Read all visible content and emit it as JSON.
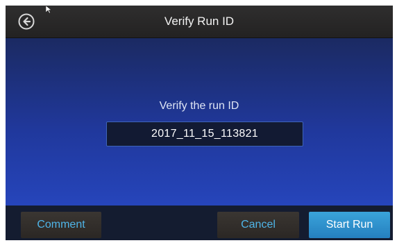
{
  "header": {
    "title": "Verify Run ID",
    "back_icon": "back-arrow-circle-icon"
  },
  "main": {
    "prompt": "Verify the run ID",
    "run_id": "2017_11_15_113821"
  },
  "footer": {
    "comment_label": "Comment",
    "cancel_label": "Cancel",
    "start_label": "Start Run"
  },
  "colors": {
    "link_blue": "#4fb5e8",
    "primary_button": "#2f8fcf",
    "background_top": "#1b2a62",
    "background_bottom": "#2645bb"
  }
}
